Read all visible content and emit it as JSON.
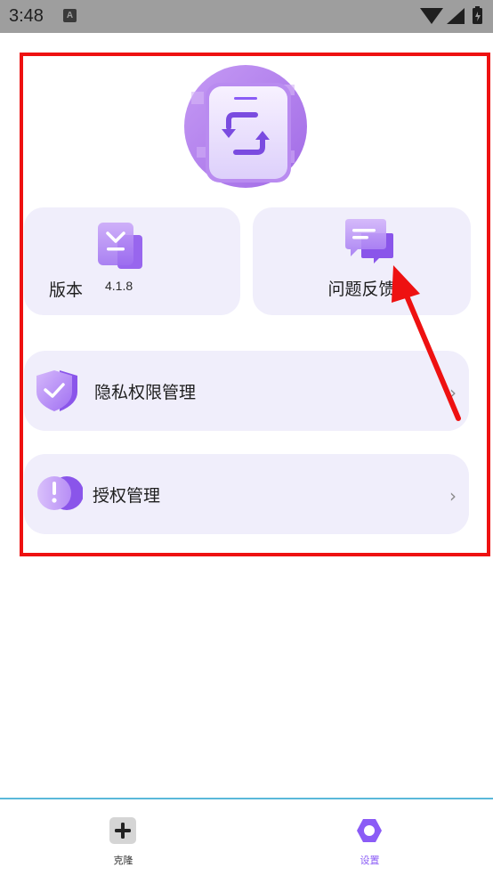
{
  "status_bar": {
    "time": "3:48",
    "notification_glyph": "A"
  },
  "version_card": {
    "label": "版本",
    "value": "4.1.8"
  },
  "feedback_card": {
    "label": "问题反馈"
  },
  "menu": [
    {
      "label": "隐私权限管理",
      "icon": "shield-check-icon"
    },
    {
      "label": "授权管理",
      "icon": "exclamation-icon"
    }
  ],
  "chevron": "›",
  "bottom_nav": [
    {
      "label": "克隆",
      "icon": "plus-icon",
      "active": false
    },
    {
      "label": "设置",
      "icon": "gear-icon",
      "active": true
    }
  ],
  "colors": {
    "accent": "#8b5cf6",
    "card_bg": "#f0eefb",
    "highlight_frame": "#ee1111",
    "annotation_arrow": "#ee1111"
  }
}
